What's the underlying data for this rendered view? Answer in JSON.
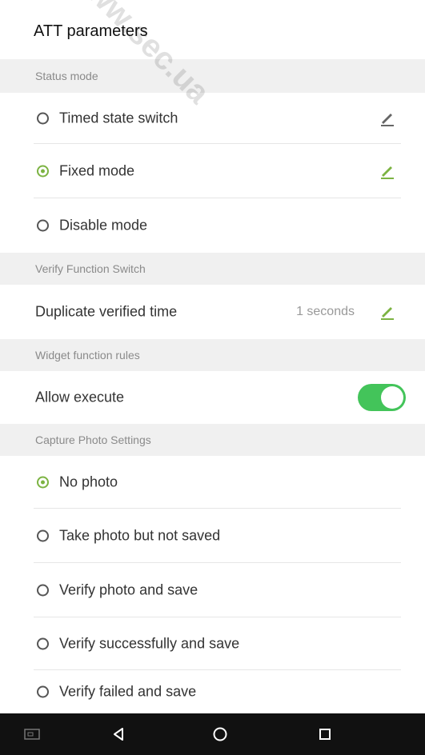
{
  "page": {
    "title": "ATT parameters"
  },
  "sections": {
    "status_mode": "Status mode",
    "verify_function_switch": "Verify Function Switch",
    "widget_function_rules": "Widget function rules",
    "capture_photo_settings": "Capture Photo Settings"
  },
  "status_mode": {
    "timed_state_switch": "Timed state switch",
    "fixed_mode": "Fixed mode",
    "disable_mode": "Disable mode",
    "selected": "fixed_mode"
  },
  "verify": {
    "duplicate_label": "Duplicate verified time",
    "duplicate_value": "1 seconds"
  },
  "widget": {
    "allow_execute_label": "Allow execute",
    "allow_execute_on": true
  },
  "capture": {
    "no_photo": "No photo",
    "take_not_saved": "Take photo but not saved",
    "verify_photo_save": "Verify photo and save",
    "verify_success_save": "Verify successfully and save",
    "verify_failed_save": "Verify failed and save",
    "selected": "no_photo"
  },
  "colors": {
    "accent": "#7cb342",
    "toggle_on": "#43c45a",
    "section_bg": "#f0f0f0",
    "navbar": "#111111"
  },
  "icons": [
    "edit-icon",
    "back-icon",
    "home-icon",
    "recents-icon",
    "screenshot-icon"
  ],
  "watermark": [
    "www.sec.ua"
  ]
}
